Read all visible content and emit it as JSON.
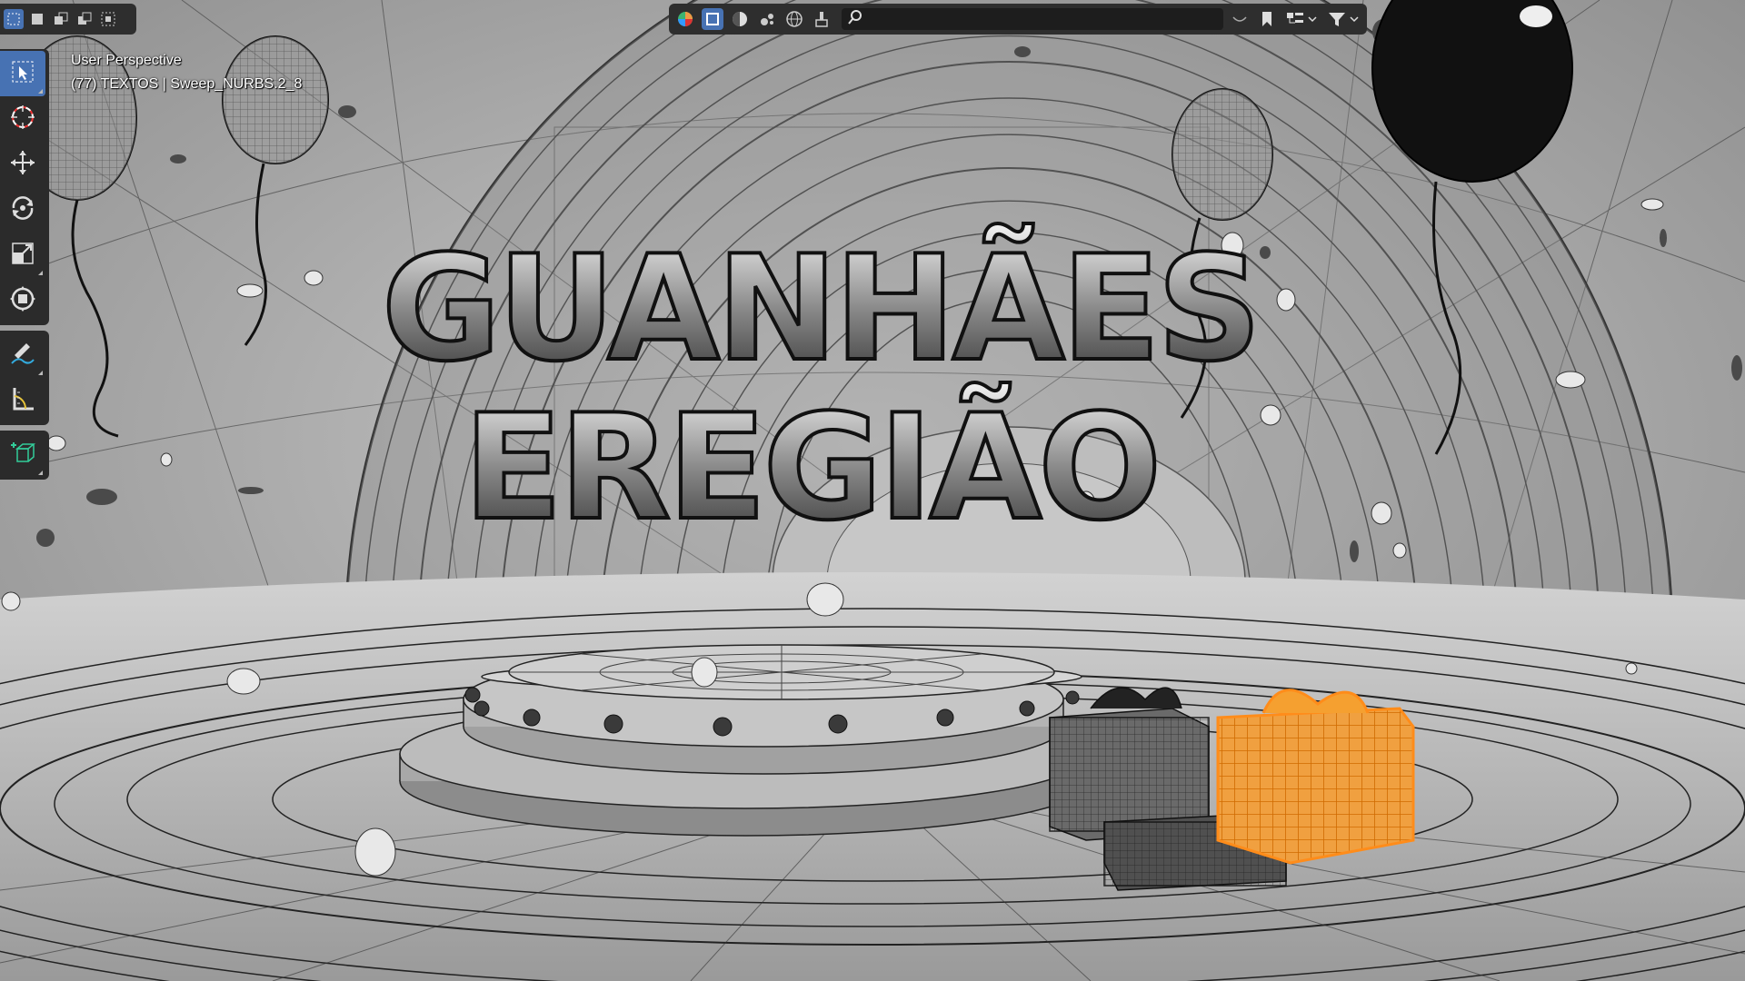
{
  "header": {
    "select_modes": [
      "select-box-icon",
      "mode-new-icon",
      "mode-extend-icon",
      "mode-subtract-icon",
      "mode-intersect-icon"
    ],
    "toolbar_icons": [
      "color-wheel-icon",
      "object-icon",
      "material-sphere-icon",
      "particles-icon",
      "world-icon",
      "brush-icon"
    ],
    "search_icon": "search-icon",
    "search_value": "",
    "right_icons": [
      "restrict-toggle-icon",
      "bookmark-icon",
      "display-mode-icon",
      "filter-icon"
    ]
  },
  "tools": {
    "group1": [
      {
        "name": "select-tool",
        "icon": "cursor-arrow-icon",
        "active": true
      },
      {
        "name": "cursor-tool",
        "icon": "3d-cursor-icon",
        "active": false
      },
      {
        "name": "move-tool",
        "icon": "move-arrows-icon",
        "active": false
      },
      {
        "name": "rotate-tool",
        "icon": "rotate-icon",
        "active": false
      },
      {
        "name": "scale-tool",
        "icon": "scale-icon",
        "active": false
      },
      {
        "name": "transform-tool",
        "icon": "transform-icon",
        "active": false
      }
    ],
    "group2": [
      {
        "name": "annotate-tool",
        "icon": "annotate-pen-icon",
        "active": false
      },
      {
        "name": "measure-tool",
        "icon": "measure-ruler-icon",
        "active": false
      }
    ],
    "group3": [
      {
        "name": "add-cube-tool",
        "icon": "add-cube-icon",
        "active": false
      }
    ]
  },
  "overlay": {
    "view_name": "User Perspective",
    "object_info": "(77) TEXTOS | Sweep_NURBS.2_8"
  },
  "scene": {
    "title_line1": "GUANHÃES",
    "title_line2": "EREGIÃO"
  },
  "colors": {
    "accent": "#4772b3",
    "selected_object": "#ff8c1a",
    "toolbar_bg": "#2e2e2e"
  }
}
